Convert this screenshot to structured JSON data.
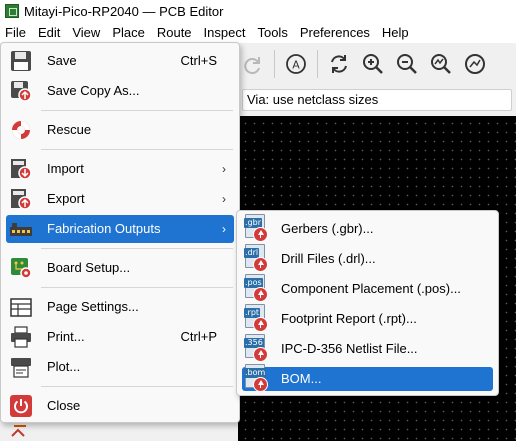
{
  "window": {
    "title": "Mitayi-Pico-RP2040 — PCB Editor"
  },
  "menubar": {
    "items": [
      "File",
      "Edit",
      "View",
      "Place",
      "Route",
      "Inspect",
      "Tools",
      "Preferences",
      "Help"
    ]
  },
  "toolbar": {
    "via_select": "Via: use netclass sizes"
  },
  "file_menu": {
    "items": [
      {
        "label": "Save",
        "shortcut": "Ctrl+S",
        "icon": "save-icon"
      },
      {
        "label": "Save Copy As...",
        "shortcut": "",
        "icon": "save-copy-icon"
      },
      {
        "label": "Rescue",
        "shortcut": "",
        "icon": "rescue-icon"
      },
      {
        "label": "Import",
        "shortcut": "",
        "icon": "import-icon",
        "submenu": true
      },
      {
        "label": "Export",
        "shortcut": "",
        "icon": "export-icon",
        "submenu": true
      },
      {
        "label": "Fabrication Outputs",
        "shortcut": "",
        "icon": "fabrication-icon",
        "submenu": true,
        "highlighted": true
      },
      {
        "label": "Board Setup...",
        "shortcut": "",
        "icon": "board-setup-icon"
      },
      {
        "label": "Page Settings...",
        "shortcut": "",
        "icon": "page-settings-icon"
      },
      {
        "label": "Print...",
        "shortcut": "Ctrl+P",
        "icon": "print-icon"
      },
      {
        "label": "Plot...",
        "shortcut": "",
        "icon": "plot-icon"
      },
      {
        "label": "Close",
        "shortcut": "",
        "icon": "close-icon"
      }
    ]
  },
  "fabrication_submenu": {
    "items": [
      {
        "label": "Gerbers (.gbr)...",
        "ext": ".gbr"
      },
      {
        "label": "Drill Files (.drl)...",
        "ext": ".drl"
      },
      {
        "label": "Component Placement (.pos)...",
        "ext": ".pos"
      },
      {
        "label": "Footprint Report (.rpt)...",
        "ext": ".rpt"
      },
      {
        "label": "IPC-D-356 Netlist File...",
        "ext": ".356"
      },
      {
        "label": "BOM...",
        "ext": ".bom",
        "highlighted": true
      }
    ]
  },
  "colors": {
    "highlight": "#1f74d1",
    "canvas": "#000000",
    "menu_bg": "#f9f9f9"
  }
}
